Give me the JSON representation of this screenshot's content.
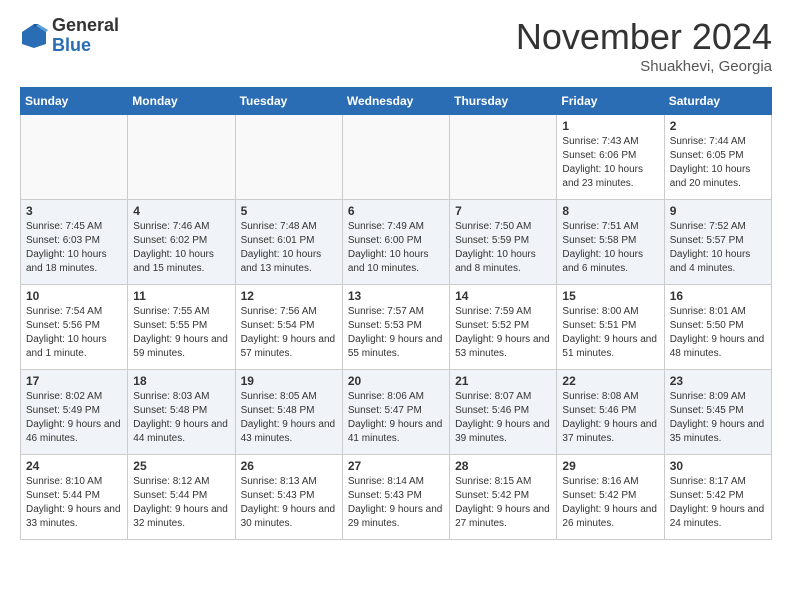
{
  "header": {
    "logo_general": "General",
    "logo_blue": "Blue",
    "title": "November 2024",
    "location": "Shuakhevi, Georgia"
  },
  "weekdays": [
    "Sunday",
    "Monday",
    "Tuesday",
    "Wednesday",
    "Thursday",
    "Friday",
    "Saturday"
  ],
  "weeks": [
    [
      {
        "day": "",
        "info": ""
      },
      {
        "day": "",
        "info": ""
      },
      {
        "day": "",
        "info": ""
      },
      {
        "day": "",
        "info": ""
      },
      {
        "day": "",
        "info": ""
      },
      {
        "day": "1",
        "info": "Sunrise: 7:43 AM\nSunset: 6:06 PM\nDaylight: 10 hours and 23 minutes."
      },
      {
        "day": "2",
        "info": "Sunrise: 7:44 AM\nSunset: 6:05 PM\nDaylight: 10 hours and 20 minutes."
      }
    ],
    [
      {
        "day": "3",
        "info": "Sunrise: 7:45 AM\nSunset: 6:03 PM\nDaylight: 10 hours and 18 minutes."
      },
      {
        "day": "4",
        "info": "Sunrise: 7:46 AM\nSunset: 6:02 PM\nDaylight: 10 hours and 15 minutes."
      },
      {
        "day": "5",
        "info": "Sunrise: 7:48 AM\nSunset: 6:01 PM\nDaylight: 10 hours and 13 minutes."
      },
      {
        "day": "6",
        "info": "Sunrise: 7:49 AM\nSunset: 6:00 PM\nDaylight: 10 hours and 10 minutes."
      },
      {
        "day": "7",
        "info": "Sunrise: 7:50 AM\nSunset: 5:59 PM\nDaylight: 10 hours and 8 minutes."
      },
      {
        "day": "8",
        "info": "Sunrise: 7:51 AM\nSunset: 5:58 PM\nDaylight: 10 hours and 6 minutes."
      },
      {
        "day": "9",
        "info": "Sunrise: 7:52 AM\nSunset: 5:57 PM\nDaylight: 10 hours and 4 minutes."
      }
    ],
    [
      {
        "day": "10",
        "info": "Sunrise: 7:54 AM\nSunset: 5:56 PM\nDaylight: 10 hours and 1 minute."
      },
      {
        "day": "11",
        "info": "Sunrise: 7:55 AM\nSunset: 5:55 PM\nDaylight: 9 hours and 59 minutes."
      },
      {
        "day": "12",
        "info": "Sunrise: 7:56 AM\nSunset: 5:54 PM\nDaylight: 9 hours and 57 minutes."
      },
      {
        "day": "13",
        "info": "Sunrise: 7:57 AM\nSunset: 5:53 PM\nDaylight: 9 hours and 55 minutes."
      },
      {
        "day": "14",
        "info": "Sunrise: 7:59 AM\nSunset: 5:52 PM\nDaylight: 9 hours and 53 minutes."
      },
      {
        "day": "15",
        "info": "Sunrise: 8:00 AM\nSunset: 5:51 PM\nDaylight: 9 hours and 51 minutes."
      },
      {
        "day": "16",
        "info": "Sunrise: 8:01 AM\nSunset: 5:50 PM\nDaylight: 9 hours and 48 minutes."
      }
    ],
    [
      {
        "day": "17",
        "info": "Sunrise: 8:02 AM\nSunset: 5:49 PM\nDaylight: 9 hours and 46 minutes."
      },
      {
        "day": "18",
        "info": "Sunrise: 8:03 AM\nSunset: 5:48 PM\nDaylight: 9 hours and 44 minutes."
      },
      {
        "day": "19",
        "info": "Sunrise: 8:05 AM\nSunset: 5:48 PM\nDaylight: 9 hours and 43 minutes."
      },
      {
        "day": "20",
        "info": "Sunrise: 8:06 AM\nSunset: 5:47 PM\nDaylight: 9 hours and 41 minutes."
      },
      {
        "day": "21",
        "info": "Sunrise: 8:07 AM\nSunset: 5:46 PM\nDaylight: 9 hours and 39 minutes."
      },
      {
        "day": "22",
        "info": "Sunrise: 8:08 AM\nSunset: 5:46 PM\nDaylight: 9 hours and 37 minutes."
      },
      {
        "day": "23",
        "info": "Sunrise: 8:09 AM\nSunset: 5:45 PM\nDaylight: 9 hours and 35 minutes."
      }
    ],
    [
      {
        "day": "24",
        "info": "Sunrise: 8:10 AM\nSunset: 5:44 PM\nDaylight: 9 hours and 33 minutes."
      },
      {
        "day": "25",
        "info": "Sunrise: 8:12 AM\nSunset: 5:44 PM\nDaylight: 9 hours and 32 minutes."
      },
      {
        "day": "26",
        "info": "Sunrise: 8:13 AM\nSunset: 5:43 PM\nDaylight: 9 hours and 30 minutes."
      },
      {
        "day": "27",
        "info": "Sunrise: 8:14 AM\nSunset: 5:43 PM\nDaylight: 9 hours and 29 minutes."
      },
      {
        "day": "28",
        "info": "Sunrise: 8:15 AM\nSunset: 5:42 PM\nDaylight: 9 hours and 27 minutes."
      },
      {
        "day": "29",
        "info": "Sunrise: 8:16 AM\nSunset: 5:42 PM\nDaylight: 9 hours and 26 minutes."
      },
      {
        "day": "30",
        "info": "Sunrise: 8:17 AM\nSunset: 5:42 PM\nDaylight: 9 hours and 24 minutes."
      }
    ]
  ]
}
